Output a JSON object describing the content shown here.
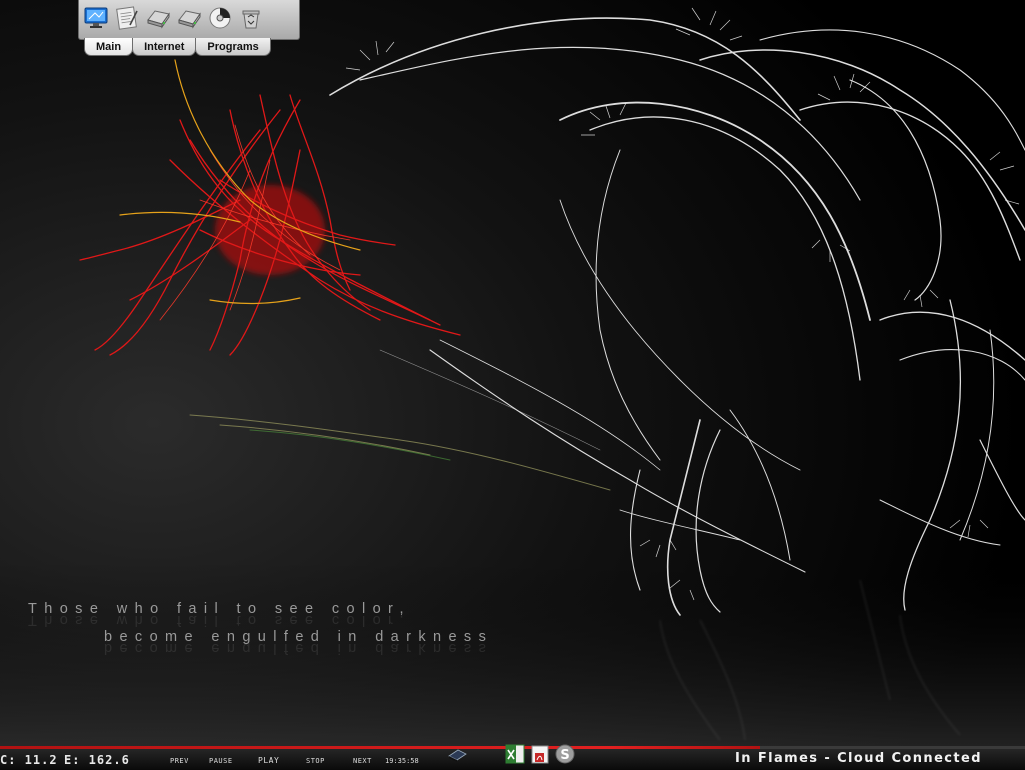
{
  "launcher": {
    "icons": [
      "monitor-icon",
      "notepad-icon",
      "drive-icon",
      "drive-icon",
      "disc-icon",
      "recycle-bin-icon"
    ],
    "tabs": [
      "Main",
      "Internet",
      "Programs"
    ],
    "active_tab": "Main"
  },
  "quote": {
    "line1": "Those who fail to see color,",
    "line2": "become engulfed in darkness"
  },
  "taskbar": {
    "drive_c": "C: 11.2",
    "drive_e": "E: 162.6",
    "media": {
      "prev": "PREV",
      "pause": "PAUSE",
      "play": "PLAY",
      "stop": "STOP",
      "next": "NEXT"
    },
    "time": "19:35:58",
    "now_playing": "In Flames - Cloud Connected",
    "tray_icons": [
      "desktop-icon",
      "excel-icon",
      "pdf-icon",
      "skype-icon"
    ]
  },
  "colors": {
    "accent": "#e22020",
    "background": "#000000",
    "text": "#e8e8e8"
  }
}
